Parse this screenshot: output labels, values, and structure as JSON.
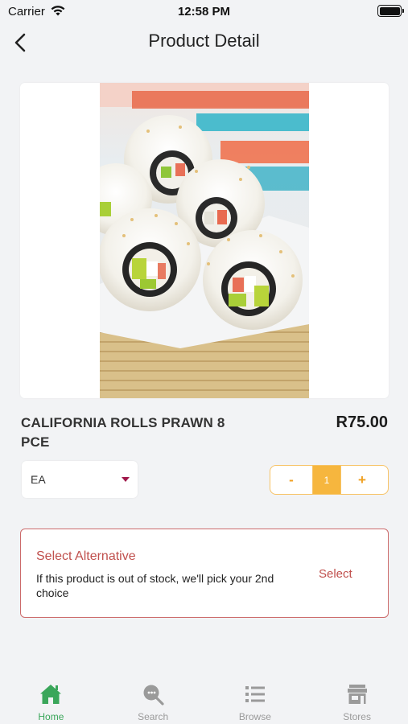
{
  "status_bar": {
    "carrier": "Carrier",
    "time": "12:58 PM",
    "battery_level": 1.0
  },
  "header": {
    "title": "Product Detail",
    "back_icon": "chevron-left-icon"
  },
  "product": {
    "image": "california-rolls-photo",
    "name": "CALIFORNIA ROLLS PRAWN 8 PCE",
    "price": "R75.00",
    "unit": "EA",
    "quantity": "1",
    "qty_minus_label": "-",
    "qty_plus_label": "+"
  },
  "alternative": {
    "title": "Select Alternative",
    "description": "If this product is out of stock, we'll pick your 2nd choice",
    "select_label": "Select"
  },
  "tab_bar": {
    "active": "home",
    "tabs": [
      {
        "id": "home",
        "label": "Home",
        "icon": "home-icon"
      },
      {
        "id": "search",
        "label": "Search",
        "icon": "search-icon"
      },
      {
        "id": "browse",
        "label": "Browse",
        "icon": "list-icon"
      },
      {
        "id": "stores",
        "label": "Stores",
        "icon": "store-icon"
      }
    ]
  },
  "colors": {
    "background": "#f2f3f5",
    "accent_orange": "#f6b63e",
    "accent_red": "#c0504d",
    "active_tab_green": "#3aa65a",
    "inactive_tab_gray": "#9a9a9a",
    "caret_maroon": "#a0184a"
  }
}
